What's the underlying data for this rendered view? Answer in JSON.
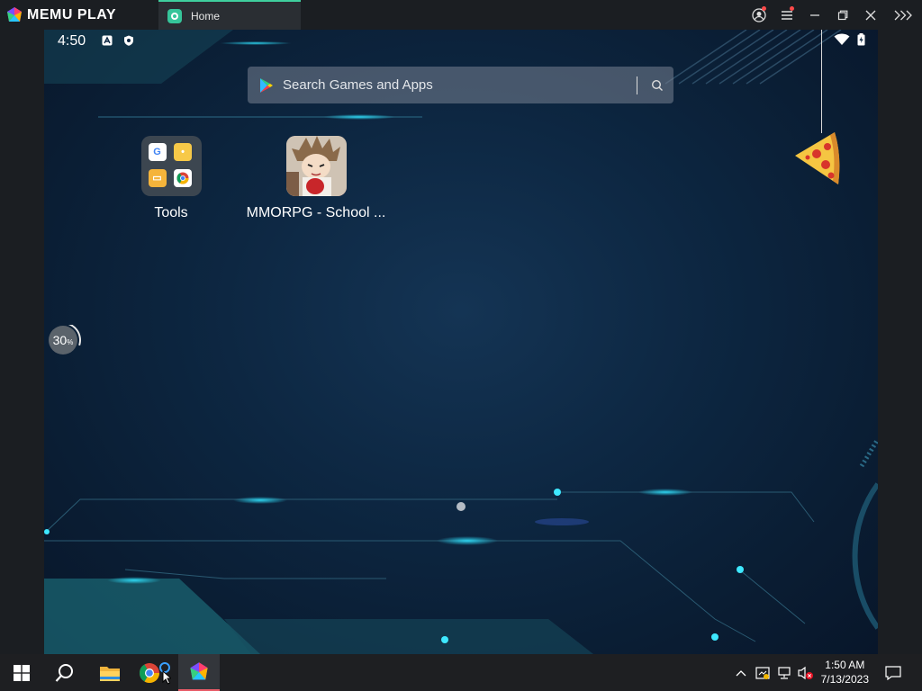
{
  "app": {
    "brand": "MEMU PLAY",
    "tab_label": "Home",
    "accent": "#3fcf9e"
  },
  "android": {
    "time": "4:50",
    "search_placeholder": "Search Games and Apps",
    "apps": [
      {
        "label": "Tools",
        "icon": "folder-icon"
      },
      {
        "label": "MMORPG - School ...",
        "icon": "game-icon"
      }
    ],
    "progress_text": "30",
    "progress_unit": "%",
    "progress_value": 0.3
  },
  "taskbar": {
    "time": "1:50 AM",
    "date": "7/13/2023"
  }
}
